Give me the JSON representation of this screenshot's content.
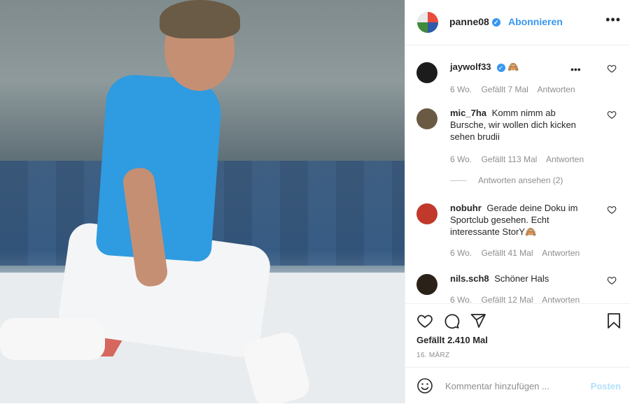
{
  "post": {
    "username": "panne08",
    "follow_label": "Abonnieren",
    "more_label": "•••"
  },
  "comments": [
    {
      "user": "jaywolf33",
      "text": "🙈",
      "age": "6 Wo.",
      "likes": "Gefällt 7 Mal",
      "reply": "Antworten",
      "more": "•••",
      "verified": true
    },
    {
      "user": "mic_7ha",
      "text": "Komm nimm ab Bursche, wir wollen dich kicken sehen brudii",
      "age": "6 Wo.",
      "likes": "Gefällt 113 Mal",
      "reply": "Antworten"
    },
    {
      "user": "nobuhr",
      "text": "Gerade deine Doku im Sportclub gesehen. Echt interessante StorY🙈",
      "age": "6 Wo.",
      "likes": "Gefällt 41 Mal",
      "reply": "Antworten"
    },
    {
      "user": "nils.sch8",
      "text": "Schöner Hals",
      "age": "6 Wo.",
      "likes": "Gefällt 12 Mal",
      "reply": "Antworten"
    }
  ],
  "view_replies": "Antworten ansehen (2)",
  "likes_total": "Gefällt 2.410 Mal",
  "date": "16. MÄRZ",
  "add_comment": {
    "placeholder": "Kommentar hinzufügen ...",
    "post_label": "Posten"
  },
  "colors": {
    "accent": "#3897f0",
    "muted": "#8e8e8e",
    "post_disabled": "#b2dffc",
    "shirt": "#2f9be0"
  }
}
